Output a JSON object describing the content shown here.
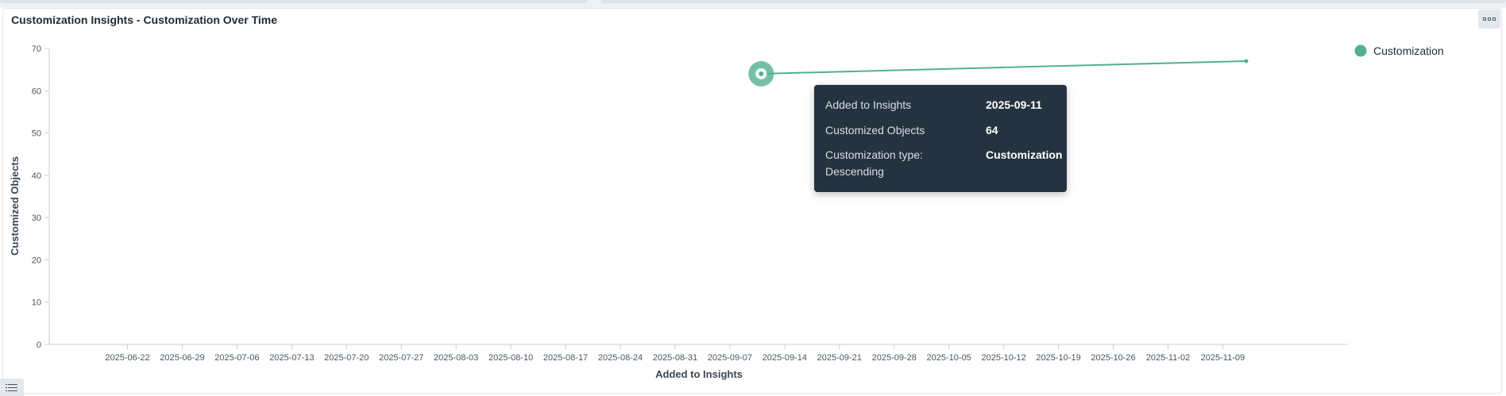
{
  "panel": {
    "title": "Customization Insights - Customization Over Time"
  },
  "chart_data": {
    "type": "line",
    "title": "Customization Insights - Customization Over Time",
    "xlabel": "Added to Insights",
    "ylabel": "Customized Objects",
    "x_tick_labels": [
      "2025-06-22",
      "2025-06-29",
      "2025-07-06",
      "2025-07-13",
      "2025-07-20",
      "2025-07-27",
      "2025-08-03",
      "2025-08-10",
      "2025-08-17",
      "2025-08-24",
      "2025-08-31",
      "2025-09-07",
      "2025-09-14",
      "2025-09-21",
      "2025-09-28",
      "2025-10-05",
      "2025-10-12",
      "2025-10-19",
      "2025-10-26",
      "2025-11-02",
      "2025-11-09"
    ],
    "xlim": [
      "2025-06-12",
      "2025-11-25"
    ],
    "ylim": [
      0,
      70
    ],
    "y_ticks": [
      0,
      10,
      20,
      30,
      40,
      50,
      60,
      70
    ],
    "grid": false,
    "legend_position": "top-right",
    "series": [
      {
        "name": "Customization",
        "color": "#52b08e",
        "x": [
          "2025-09-11",
          "2025-11-12"
        ],
        "y": [
          64,
          67
        ]
      }
    ],
    "highlight_index": 0
  },
  "tooltip": {
    "rows": [
      {
        "label": "Added to Insights",
        "value": "2025-09-11"
      },
      {
        "label": "Customized Objects",
        "value": "64"
      },
      {
        "label": "Customization type: Descending",
        "value": "Customization"
      }
    ]
  },
  "icons": {
    "menu": "more-icon",
    "list": "list-icon"
  }
}
